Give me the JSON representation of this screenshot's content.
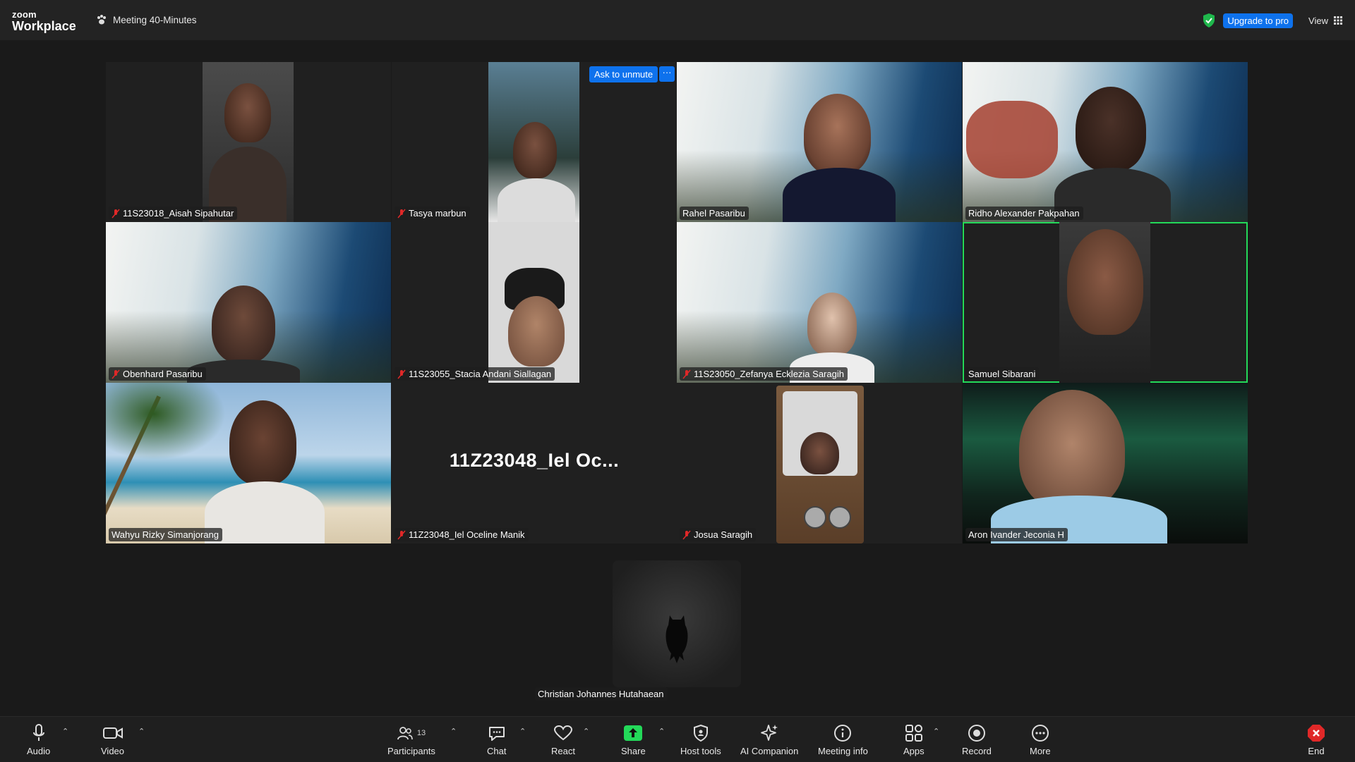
{
  "app": {
    "brand_small": "zoom",
    "brand_big": "Workplace",
    "meeting_title": "Meeting 40-Minutes"
  },
  "top_right": {
    "upgrade": "Upgrade to pro",
    "view": "View"
  },
  "tile_actions": {
    "ask_unmute": "Ask to unmute",
    "more": "···"
  },
  "participants": [
    {
      "name": "11S23018_Aisah Sipahutar",
      "muted": true
    },
    {
      "name": "Tasya marbun",
      "muted": true
    },
    {
      "name": "Rahel Pasaribu",
      "muted": false
    },
    {
      "name": "Ridho Alexander Pakpahan",
      "muted": false
    },
    {
      "name": "Obenhard Pasaribu",
      "muted": true
    },
    {
      "name": "11S23055_Stacia Andani Siallagan",
      "muted": true
    },
    {
      "name": "11S23050_Zefanya Ecklezia Saragih",
      "muted": true
    },
    {
      "name": "Samuel Sibarani",
      "muted": false
    },
    {
      "name": "Wahyu Rizky Simanjorang",
      "muted": false
    },
    {
      "name": "11Z23048_Iel Oceline Manik",
      "muted": true,
      "big_label": "11Z23048_Iel  Oc..."
    },
    {
      "name": "Josua Saragih",
      "muted": true
    },
    {
      "name": "Aron Ivander Jeconia H",
      "muted": false
    },
    {
      "name": "Christian Johannes Hutahaean",
      "muted": false
    }
  ],
  "toolbar": {
    "audio": "Audio",
    "video": "Video",
    "participants": "Participants",
    "participants_count": "13",
    "chat": "Chat",
    "react": "React",
    "share": "Share",
    "host_tools": "Host tools",
    "ai_companion": "AI Companion",
    "meeting_info": "Meeting info",
    "apps": "Apps",
    "record": "Record",
    "more": "More",
    "end": "End"
  },
  "colors": {
    "accent": "#0e72ed",
    "active_speaker": "#23d959",
    "end": "#e02828",
    "share": "#23d959"
  }
}
